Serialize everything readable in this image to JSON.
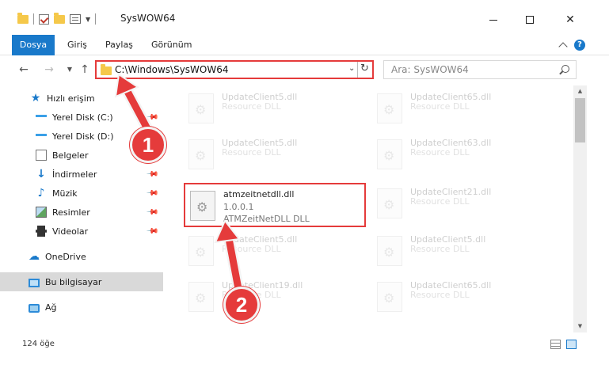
{
  "window": {
    "title": "SysWOW64"
  },
  "ribbon": {
    "tabs": [
      {
        "label": "Dosya"
      },
      {
        "label": "Giriş"
      },
      {
        "label": "Paylaş"
      },
      {
        "label": "Görünüm"
      }
    ]
  },
  "address": {
    "path": "C:\\Windows\\SysWOW64"
  },
  "search": {
    "placeholder": "Ara: SysWOW64"
  },
  "sidebar": {
    "items": [
      {
        "label": "Hızlı erişim",
        "icon": "star-icon",
        "pinned": false
      },
      {
        "label": "Yerel Disk (C:)",
        "icon": "drive-icon",
        "pinned": true
      },
      {
        "label": "Yerel Disk (D:)",
        "icon": "drive-icon",
        "pinned": false
      },
      {
        "label": "Belgeler",
        "icon": "documents-icon",
        "pinned": false
      },
      {
        "label": "İndirmeler",
        "icon": "download-icon",
        "pinned": true
      },
      {
        "label": "Müzik",
        "icon": "music-icon",
        "pinned": true
      },
      {
        "label": "Resimler",
        "icon": "pictures-icon",
        "pinned": true
      },
      {
        "label": "Videolar",
        "icon": "video-icon",
        "pinned": true
      },
      {
        "label": "OneDrive",
        "icon": "cloud-icon",
        "pinned": false
      },
      {
        "label": "Bu bilgisayar",
        "icon": "pc-icon",
        "pinned": false,
        "selected": true
      },
      {
        "label": "Ağ",
        "icon": "network-icon",
        "pinned": false
      }
    ]
  },
  "files": {
    "left": [
      {
        "name": "UpdateClient5.dll",
        "desc": "Resource DLL"
      },
      {
        "name": "UpdateClient5.dll",
        "desc": "Resource DLL"
      },
      {
        "name": "atmzeitnetdll.dll",
        "version": "1.0.0.1",
        "desc": "ATMZeitNetDLL DLL"
      },
      {
        "name": "UpdateClient5.dll",
        "desc": "Resource DLL"
      },
      {
        "name": "UpdateClient19.dll",
        "desc": "Resource DLL"
      }
    ],
    "right": [
      {
        "name": "UpdateClient65.dll",
        "desc": "Resource DLL"
      },
      {
        "name": "UpdateClient63.dll",
        "desc": "Resource DLL"
      },
      {
        "name": "UpdateClient21.dll",
        "desc": "Resource DLL"
      },
      {
        "name": "UpdateClient5.dll",
        "desc": "Resource DLL"
      },
      {
        "name": "UpdateClient65.dll",
        "desc": "Resource DLL"
      }
    ]
  },
  "status": {
    "item_count": "124 öğe"
  },
  "annotations": {
    "step1": "1",
    "step2": "2",
    "color": "#e53b3b"
  }
}
